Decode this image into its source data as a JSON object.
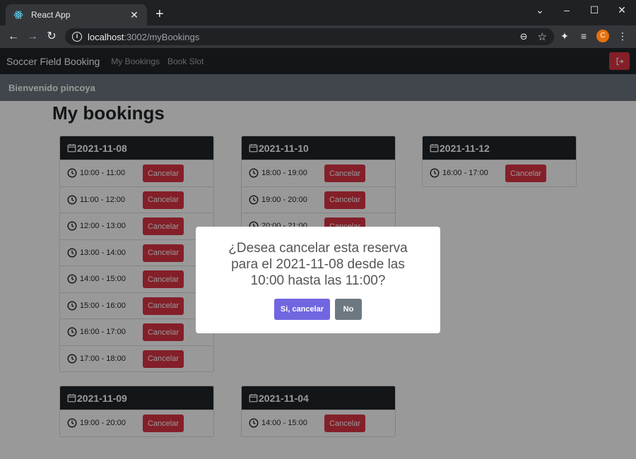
{
  "browser": {
    "tab_title": "React App",
    "url_host": "localhost",
    "url_rest": ":3002/myBookings",
    "profile_initial": "C"
  },
  "navbar": {
    "brand": "Soccer Field Booking",
    "links": [
      "My Bookings",
      "Book Slot"
    ]
  },
  "welcome": "Bienvenido pincoya",
  "page_title": "My bookings",
  "cancel_label": "Cancelar",
  "bookings": [
    {
      "date": "2021-11-08",
      "slots": [
        "10:00 - 11:00",
        "11:00 - 12:00",
        "12:00 - 13:00",
        "13:00 - 14:00",
        "14:00 - 15:00",
        "15:00 - 16:00",
        "16:00 - 17:00",
        "17:00 - 18:00"
      ]
    },
    {
      "date": "2021-11-10",
      "slots": [
        "18:00 - 19:00",
        "19:00 - 20:00",
        "20:00 - 21:00"
      ]
    },
    {
      "date": "2021-11-12",
      "slots": [
        "16:00 - 17:00"
      ]
    },
    {
      "date": "2021-11-09",
      "slots": [
        "19:00 - 20:00"
      ]
    },
    {
      "date": "2021-11-04",
      "slots": [
        "14:00 - 15:00"
      ]
    }
  ],
  "modal": {
    "message": "¿Desea cancelar esta reserva para el 2021-11-08 desde las 10:00 hasta las 11:00?",
    "confirm_label": "Si, cancelar",
    "deny_label": "No"
  },
  "colors": {
    "danger": "#dc3545",
    "dark": "#212529",
    "secondary": "#6c757d",
    "confirm": "#7066e0"
  }
}
